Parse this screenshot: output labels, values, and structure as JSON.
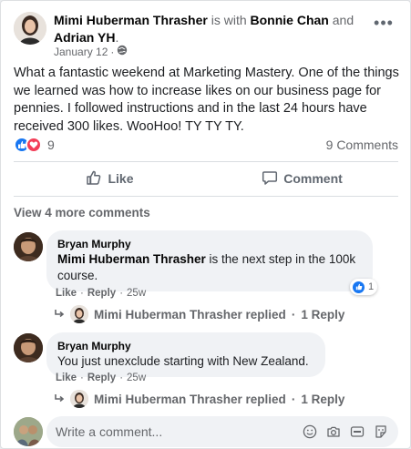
{
  "post": {
    "author": "Mimi Huberman Thrasher",
    "with_text": "is with",
    "tagged_1": "Bonnie Chan",
    "and_text": "and",
    "tagged_2": "Adrian YH",
    "period": ".",
    "date": "January 12",
    "separator": "·",
    "privacy_icon": "globe-icon",
    "more_label": "•••",
    "text": "What a fantastic weekend at Marketing Mastery. One of the things we learned was how to increase likes on our business page for pennies.  I followed instructions and in the last 24 hours have received 300 likes. WooHoo! TY TY TY."
  },
  "reactions": {
    "count": "9",
    "comments_count": "9 Comments",
    "like_color": "#1877f2",
    "love_color": "#f33e58"
  },
  "actions": {
    "like_label": "Like",
    "comment_label": "Comment"
  },
  "view_more": "View 4 more comments",
  "comments": [
    {
      "author": "Bryan Murphy",
      "tag": "Mimi Huberman Thrasher",
      "text": " is the next step in the 100k course.",
      "like": "Like",
      "reply": "Reply",
      "dot": "·",
      "time": "25w",
      "reaction_count": "1",
      "replies_author": "Mimi Huberman Thrasher replied",
      "replies_dot": "·",
      "replies_count": "1 Reply"
    },
    {
      "author": "Bryan Murphy",
      "text": "You just unexclude starting with New Zealand.",
      "like": "Like",
      "reply": "Reply",
      "dot": "·",
      "time": "25w",
      "replies_author": "Mimi Huberman Thrasher replied",
      "replies_dot": "·",
      "replies_count": "1 Reply"
    }
  ],
  "write": {
    "placeholder": "Write a comment..."
  }
}
